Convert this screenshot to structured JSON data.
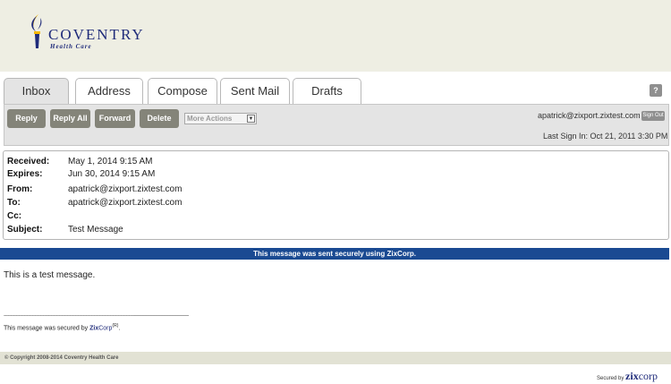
{
  "brand": {
    "name": "COVENTRY",
    "subtitle": "Health Care",
    "logo_color": "#1f2b7a",
    "accent_color": "#f5b800"
  },
  "tabs": [
    {
      "label": "Inbox",
      "active": true
    },
    {
      "label": "Address",
      "active": false
    },
    {
      "label": "Compose",
      "active": false
    },
    {
      "label": "Sent Mail",
      "active": false
    },
    {
      "label": "Drafts",
      "active": false
    }
  ],
  "help_label": "?",
  "toolbar": {
    "buttons": [
      {
        "label": "Reply"
      },
      {
        "label": "Reply All"
      },
      {
        "label": "Forward"
      },
      {
        "label": "Delete"
      }
    ],
    "more_actions": "More Actions",
    "user_email": "apatrick@zixport.zixtest.com",
    "sign_out": "Sign Out",
    "last_sign_in": "Last Sign In: Oct 21, 2011 3:30 PM"
  },
  "message": {
    "fields": [
      {
        "label": "Received:",
        "value": "May 1, 2014 9:15 AM"
      },
      {
        "label": "Expires:",
        "value": "Jun 30, 2014 9:15 AM"
      },
      {
        "label": "From:",
        "value": "apatrick@zixport.zixtest.com"
      },
      {
        "label": "To:",
        "value": "apatrick@zixport.zixtest.com"
      },
      {
        "label": "Cc:",
        "value": ""
      },
      {
        "label": "Subject:",
        "value": "Test Message"
      }
    ],
    "secure_banner": "This message was sent securely using ZixCorp.",
    "body": "This is a test message.",
    "separator": "------------------------------------------------------------------------------------------------------------------------------------------",
    "secured_by_prefix": "This message was secured by ",
    "zix_z": "Zix",
    "zix_rest": "Corp",
    "zix_reg": "(R)",
    "secured_by_suffix": "."
  },
  "footer": {
    "copyright": "© Copyright 2008-2014 Coventry Health Care",
    "secured_badge_prefix": "Secured by",
    "secured_badge_logo_z": "zix",
    "secured_badge_logo_rest": "corp"
  },
  "colors": {
    "header_bg": "#eeeee3",
    "button_bg": "#848479",
    "secure_bar": "#1a4a92",
    "footer_bg": "#e2e2d4"
  }
}
